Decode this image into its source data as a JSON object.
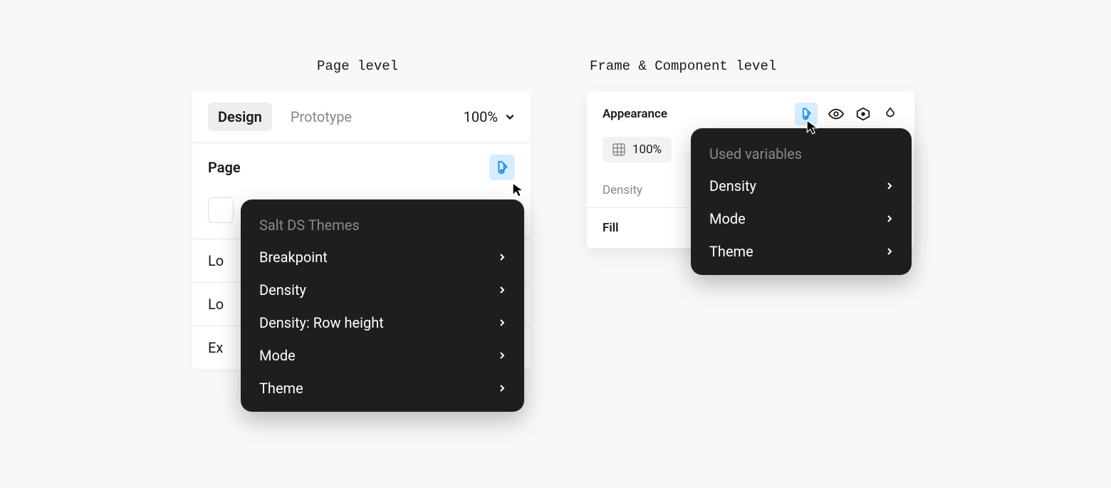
{
  "captions": {
    "left": "Page level",
    "right": "Frame & Component level"
  },
  "leftPanel": {
    "tabs": {
      "design": "Design",
      "prototype": "Prototype"
    },
    "zoom": "100%",
    "pageSection": "Page",
    "rows": [
      "Lo",
      "Lo",
      "Ex"
    ]
  },
  "leftPopover": {
    "title": "Salt DS Themes",
    "items": [
      "Breakpoint",
      "Density",
      "Density: Row height",
      "Mode",
      "Theme"
    ]
  },
  "rightPanel": {
    "appearance": "Appearance",
    "opacity": "100%",
    "densityLabel": "Density",
    "fillLabel": "Fill"
  },
  "rightPopover": {
    "title": "Used variables",
    "items": [
      "Density",
      "Mode",
      "Theme"
    ]
  }
}
